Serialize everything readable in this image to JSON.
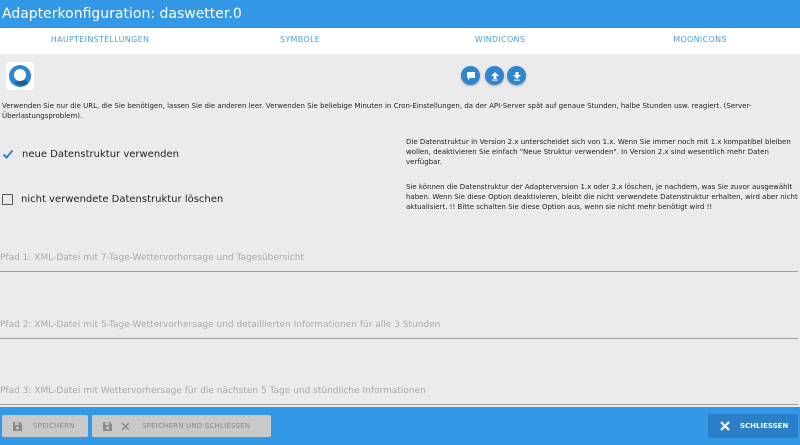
{
  "window": {
    "title": "Adapterkonfiguration: daswetter.0"
  },
  "tabs": [
    "HAUPTEINSTELLUNGEN",
    "SYMBOLE",
    "WINDICONS",
    "MOONICONS"
  ],
  "intro_text": "Verwenden Sie nur die URL, die Sie benötigen, lassen Sie die anderen leer. Verwenden Sie beliebige Minuten in Cron-Einstellungen, da der API-Server spät auf genaue Stunden, halbe Stunden usw. reagiert. (Server-Überlastungsproblem).",
  "options": [
    {
      "label": "neue Datenstruktur verwenden",
      "checked": true,
      "help": "Die Datenstruktur in Version 2.x unterscheidet sich von 1.x. Wenn Sie immer noch mit 1.x kompatibel bleiben wollen, deaktivieren Sie einfach \"Neue Struktur verwenden\". In Version 2.x sind wesentlich mehr Daten verfügbar."
    },
    {
      "label": "nicht verwendete Datenstruktur löschen",
      "checked": false,
      "help": "Sie können die Datenstruktur der Adapterversion 1.x oder 2.x löschen, je nachdem, was Sie zuvor ausgewählt haben. Wenn Sie diese Option deaktivieren, bleibt die nicht verwendete Datenstruktur erhalten, wird aber nicht aktualisiert. !! Bitte schalten Sie diese Option aus, wenn sie nicht mehr benötigt wird !!"
    }
  ],
  "fields": [
    {
      "placeholder": "Pfad 1: XML-Datei mit 7-Tage-Wettervorhersage und Tagesübersicht",
      "value": ""
    },
    {
      "placeholder": "Pfad 2: XML-Datei mit 5-Tage-Wettervorhersage und detaillierten Informationen für alle 3 Stunden",
      "value": ""
    },
    {
      "placeholder": "Pfad 3: XML-Datei mit Wettervorhersage für die nächsten 5 Tage und stündliche Informationen",
      "value": ""
    }
  ],
  "footer": {
    "save": "SPEICHERN",
    "save_close": "SPEICHERN UND SCHLIESSEN",
    "close": "SCHLIESSEN"
  },
  "colors": {
    "accent": "#3399e6",
    "tab_text": "#4a9fe0",
    "icon_button": "#2f86cf",
    "close_button": "#2a7fc6"
  }
}
